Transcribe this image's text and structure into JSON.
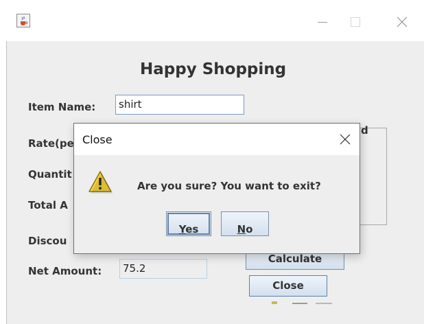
{
  "window": {
    "title": "",
    "icon": "java-cup-icon",
    "controls": [
      "minimize-icon",
      "maximize-icon",
      "close-icon"
    ]
  },
  "form": {
    "heading": "Happy Shopping",
    "item_name_label": "Item Name:",
    "item_name_value": "shirt",
    "rate_label_visible": "Rate(pe",
    "quantity_label_visible": "Quantit",
    "total_label_visible": "Total A",
    "discount_label_visible": "Discou",
    "net_amount_label": "Net Amount:",
    "net_amount_value": "75.2",
    "groupbox_title_visible": "d",
    "calculate_button": "Calculate",
    "close_button": "Close"
  },
  "dialog": {
    "title": "Close",
    "icon": "warning-icon",
    "message": "Are you sure? You want to exit?",
    "yes_button": {
      "mnemonic": "Y",
      "rest": "es"
    },
    "no_button": {
      "mnemonic": "N",
      "rest": "o"
    }
  },
  "colors": {
    "content_bg": "#eeeeee",
    "button_gradient_top": "#eef4fb",
    "button_gradient_bottom": "#d4e0ee",
    "field_border": "#7a9cc6",
    "warning_yellow": "#f4d33d"
  }
}
